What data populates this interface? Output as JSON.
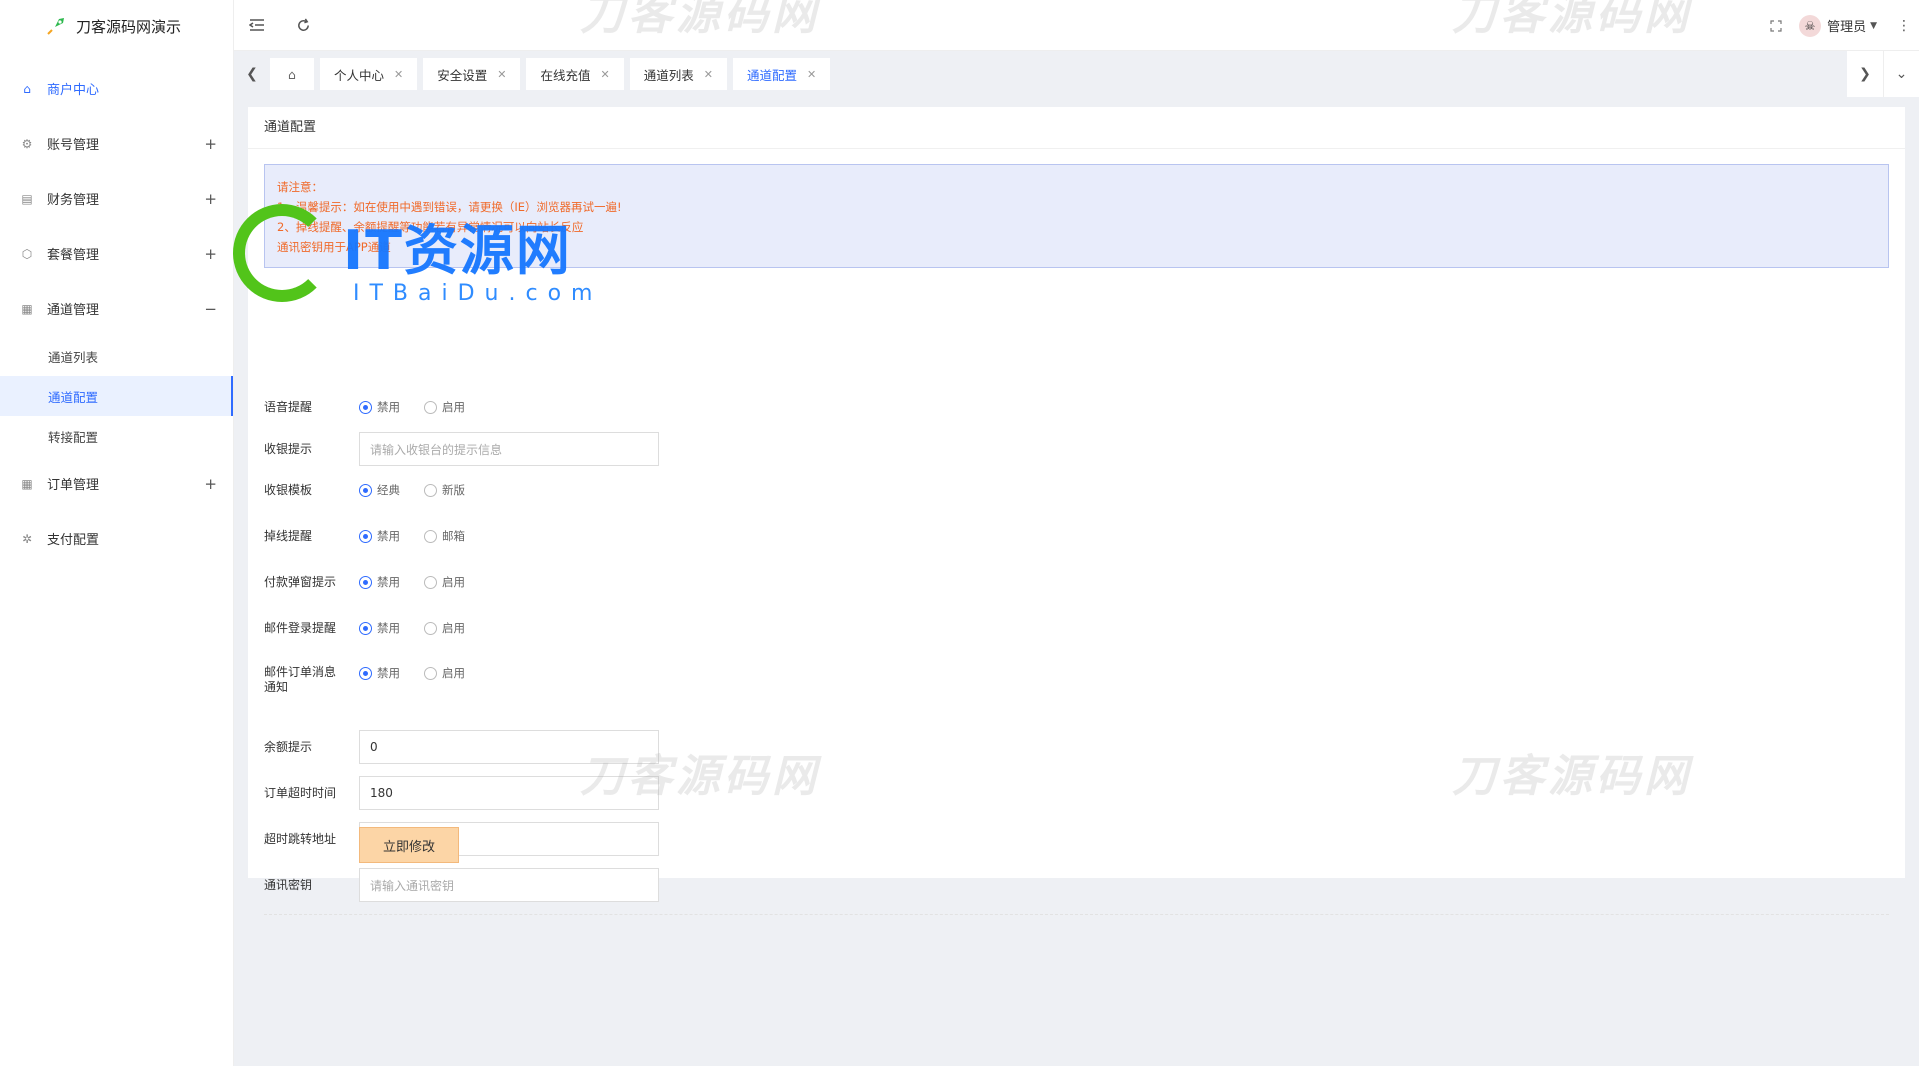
{
  "app": {
    "title": "刀客源码网演示"
  },
  "sidebar": {
    "items": [
      {
        "label": "商户中心",
        "icon": "home-icon"
      },
      {
        "label": "账号管理",
        "icon": "gear-icon",
        "toggle": "+"
      },
      {
        "label": "财务管理",
        "icon": "finance-icon",
        "toggle": "+"
      },
      {
        "label": "套餐管理",
        "icon": "package-icon",
        "toggle": "+"
      },
      {
        "label": "通道管理",
        "icon": "channel-icon",
        "toggle": "−"
      }
    ],
    "submenu": [
      {
        "label": "通道列表"
      },
      {
        "label": "通道配置"
      },
      {
        "label": "转接配置"
      }
    ],
    "items_after": [
      {
        "label": "订单管理",
        "icon": "order-icon",
        "toggle": "+"
      },
      {
        "label": "支付配置",
        "icon": "pay-config-icon"
      }
    ]
  },
  "header": {
    "user": "管理员"
  },
  "tabs": [
    {
      "label": "个人中心"
    },
    {
      "label": "安全设置"
    },
    {
      "label": "在线充值"
    },
    {
      "label": "通道列表"
    },
    {
      "label": "通道配置"
    }
  ],
  "card": {
    "title": "通道配置",
    "notice": [
      "请注意：",
      "1、温馨提示：如在使用中遇到错误，请更换（IE）浏览器再试一遍!",
      "2、掉线提醒、余额提醒等功能若有异常情况可以向站长反应",
      "   通讯密钥用于APP通道"
    ]
  },
  "form": {
    "voice_label": "语音提醒",
    "voice_opt1": "禁用",
    "voice_opt2": "启用",
    "cashier_tip_label": "收银提示",
    "cashier_tip_placeholder": "请输入收银台的提示信息",
    "template_label": "收银模板",
    "template_opt1": "经典",
    "template_opt2": "新版",
    "offline_label": "掉线提醒",
    "offline_opt1": "禁用",
    "offline_opt2": "邮箱",
    "payment_popup_label": "付款弹窗提示",
    "payment_popup_opt1": "禁用",
    "payment_popup_opt2": "启用",
    "mail_login_label": "邮件登录提醒",
    "mail_login_opt1": "禁用",
    "mail_login_opt2": "启用",
    "mail_order_label": "邮件订单消息通知",
    "mail_order_opt1": "禁用",
    "mail_order_opt2": "启用",
    "balance_label": "余额提示",
    "balance_value": "0",
    "timeout_label": "订单超时时间",
    "timeout_value": "180",
    "redirect_label": "超时跳转地址",
    "redirect_value": "/",
    "secret_label": "通讯密钥",
    "secret_placeholder": "请输入通讯密钥",
    "submit_label": "立即修改"
  },
  "watermarks": {
    "text": "刀客源码网",
    "brand": "IT资源网",
    "brand_sub": "ITBaiDu.com"
  },
  "colors": {
    "accent": "#2f6bff",
    "notice_text": "#f06a2a",
    "button_bg": "#fcd5a6"
  }
}
